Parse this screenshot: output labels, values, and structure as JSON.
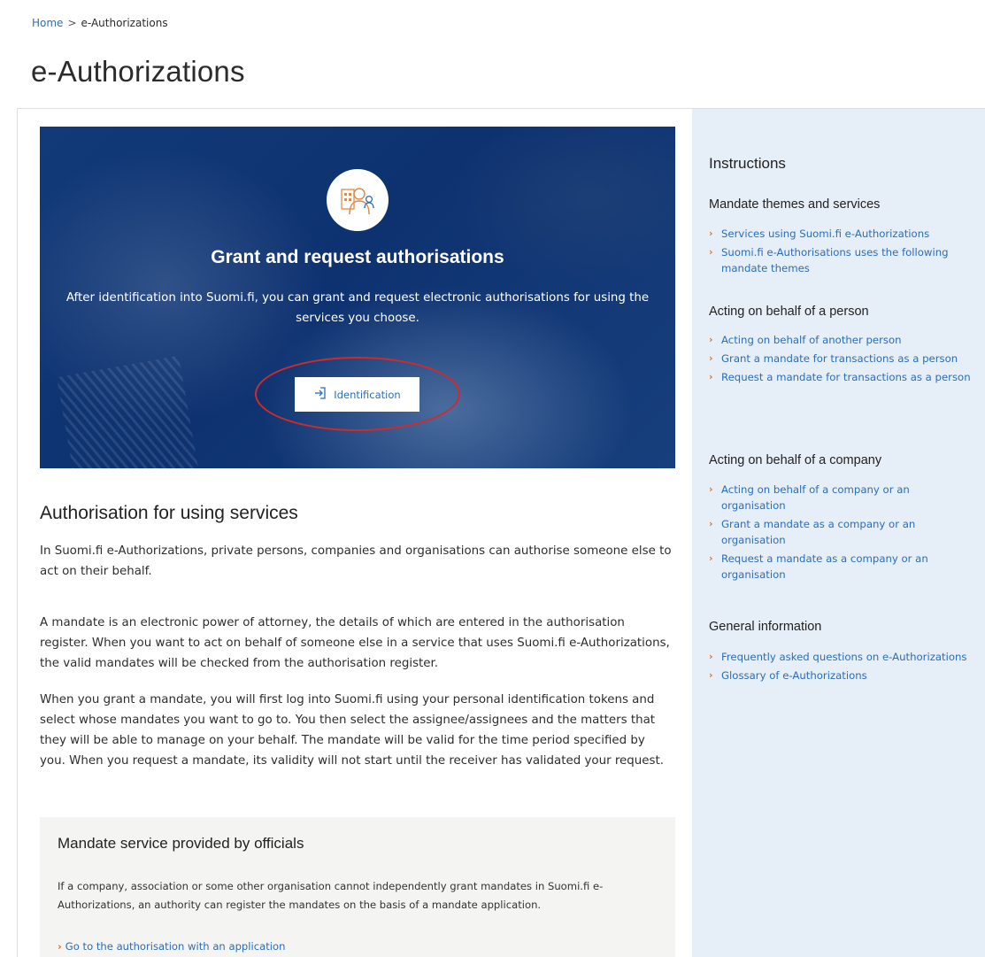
{
  "breadcrumb": {
    "home": "Home",
    "separator": ">",
    "current": "e-Authorizations"
  },
  "page": {
    "title": "e-Authorizations"
  },
  "hero": {
    "title": "Grant and request authorisations",
    "text": "After identification into Suomi.fi, you can grant and request electronic authorisations for using the services you choose.",
    "button_label": "Identification"
  },
  "main": {
    "section_title": "Authorisation for using services",
    "paragraphs": [
      "In Suomi.fi e-Authorizations, private persons, companies and organisations can authorise someone else to act on their behalf.",
      "A mandate is an electronic power of attorney, the details of which are entered in the authorisation register. When you want to act on behalf of someone else in a service that uses Suomi.fi e-Authorizations, the valid mandates will be checked from the authorisation register.",
      "When you grant a mandate, you will first log into Suomi.fi using your personal identification tokens and select whose mandates you want to go to. You then select the assignee/assignees and the matters that they will be able to manage on your behalf. The mandate will be valid for the time period specified by you. When you request a mandate, its validity will not start until the receiver has validated your request."
    ]
  },
  "officials_box": {
    "title": "Mandate service provided by officials",
    "text": "If a company, association or some other organisation cannot independently grant mandates in Suomi.fi e-Authorizations, an authority can register the mandates on the basis of a mandate application.",
    "link": "Go to the authorisation with an application"
  },
  "sidebar": {
    "title": "Instructions",
    "groups": [
      {
        "title": "Mandate themes and services",
        "links": [
          "Services using Suomi.fi e-Authorizations",
          "Suomi.fi e-Authorisations uses the following mandate themes"
        ]
      },
      {
        "title": "Acting on behalf of a person",
        "links": [
          "Acting on behalf of another person",
          "Grant a mandate for transactions as a person",
          "Request a mandate for transactions as a person"
        ]
      },
      {
        "title": "Acting on behalf of a company",
        "links": [
          "Acting on behalf of a company or an organisation",
          "Grant a mandate as a company or an organisation",
          "Request a mandate as a company or an organisation"
        ]
      },
      {
        "title": "General information",
        "links": [
          "Frequently asked questions on e-Authorizations",
          "Glossary of e-Authorizations"
        ]
      }
    ]
  },
  "colors": {
    "hero_blue": "#123a78",
    "link_blue": "#2a6ebb",
    "chevron_orange": "#d9762a",
    "sidebar_bg": "#e6eef7",
    "highlight_red": "#d22a2a"
  },
  "icons": {
    "emblem": "person-building-icon",
    "login": "login-arrow-icon",
    "chevron": "chevron-right-icon"
  }
}
